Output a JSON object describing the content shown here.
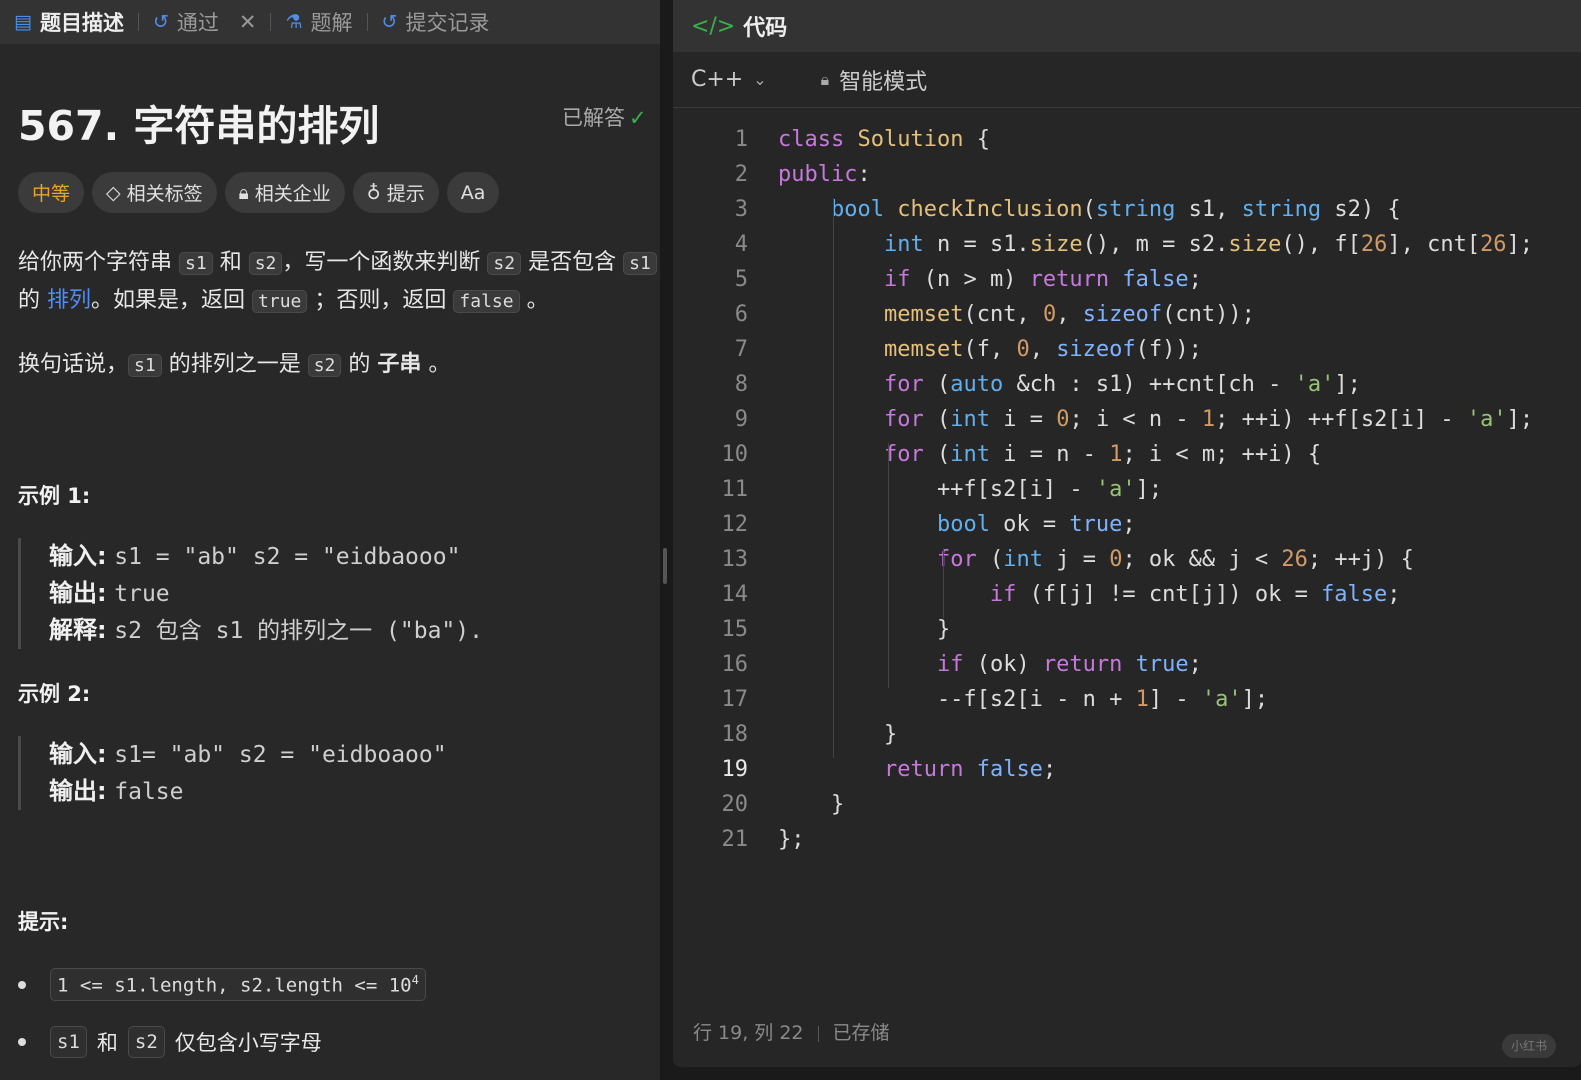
{
  "left_tabs": [
    {
      "label": "题目描述",
      "icon": "doc-icon"
    },
    {
      "label": "通过",
      "icon": "history-icon"
    },
    {
      "label": "题解",
      "icon": "flask-icon"
    },
    {
      "label": "提交记录",
      "icon": "history-icon"
    }
  ],
  "problem": {
    "title": "567. 字符串的排列",
    "status": "已解答",
    "tags": [
      "中等",
      "相关标签",
      "相关企业",
      "提示",
      "Aa"
    ],
    "desc": {
      "t1": "给你两个字符串",
      "c_s1": "s1",
      "and": "和",
      "c_s2": "s2",
      "t2": "，写一个函数来判断",
      "t3": "是否包含",
      "t4": "的",
      "link": "排列",
      "t5": "。如果是，返回",
      "c_true": "true",
      "t6": "；否则，返回",
      "c_false": "false",
      "t7": "。",
      "p2a": "换句话说，",
      "p2b": "的排列之一是",
      "p2c": "的",
      "p2d": "子串",
      "p2e": "。"
    },
    "example1": {
      "title": "示例 1:",
      "input_label": "输入:",
      "input": "s1 = \"ab\" s2 = \"eidbaooo\"",
      "output_label": "输出:",
      "output": "true",
      "explain_label": "解释:",
      "explain": "s2 包含 s1 的排列之一 (\"ba\")."
    },
    "example2": {
      "title": "示例 2:",
      "input_label": "输入:",
      "input": "s1= \"ab\" s2 = \"eidboaoo\"",
      "output_label": "输出:",
      "output": "false"
    },
    "hints": {
      "title": "提示:",
      "b1": "1 <= s1.length, s2.length <= 10",
      "b1_sup": "4",
      "b2_a": "s1",
      "b2_and": "和",
      "b2_b": "s2",
      "b2_text": "仅包含小写字母"
    }
  },
  "code_panel": {
    "title": "代码",
    "language": "C++",
    "mode": "智能模式",
    "lines": [
      "class Solution {",
      "public:",
      "    bool checkInclusion(string s1, string s2) {",
      "        int n = s1.size(), m = s2.size(), f[26], cnt[26];",
      "        if (n > m) return false;",
      "        memset(cnt, 0, sizeof(cnt));",
      "        memset(f, 0, sizeof(f));",
      "        for (auto &ch : s1) ++cnt[ch - 'a'];",
      "        for (int i = 0; i < n - 1; ++i) ++f[s2[i] - 'a'];",
      "        for (int i = n - 1; i < m; ++i) {",
      "            ++f[s2[i] - 'a'];",
      "            bool ok = true;",
      "            for (int j = 0; ok && j < 26; ++j) {",
      "                if (f[j] != cnt[j]) ok = false;",
      "            }",
      "            if (ok) return true;",
      "            --f[s2[i - n + 1] - 'a'];",
      "        }",
      "        return false;",
      "    }",
      "};"
    ],
    "current_line": 19,
    "status_pos": "行 19, 列 22",
    "status_saved": "已存储"
  },
  "watermark": "小红书",
  "colors": {
    "accent_green": "#37b24d",
    "link_blue": "#4c8df6",
    "medium_orange": "#e8a526"
  }
}
